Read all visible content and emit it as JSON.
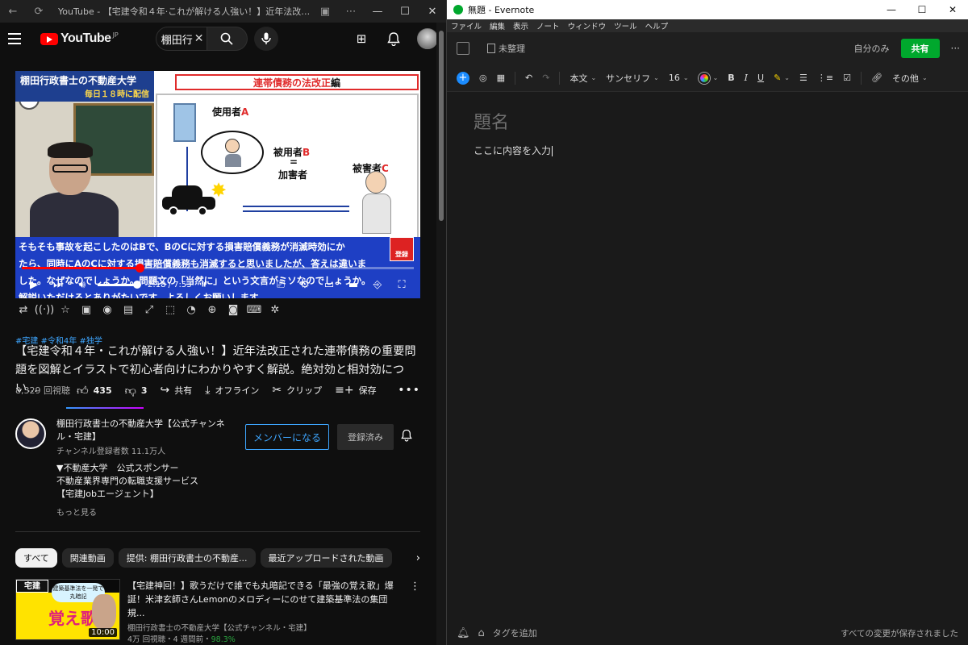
{
  "youtube_window": {
    "title": "YouTube - 【宅建令和４年·これが解ける人強い！】近年法改正された..."
  },
  "masthead": {
    "logo_text": "YouTube",
    "region": "JP",
    "search_value": "棚田行"
  },
  "player": {
    "header_channel": "棚田行政書士の不動産大学",
    "header_schedule": "毎日１８時に配信",
    "slide_topic_red": "連帯債務の法改正",
    "slide_topic_black": "編",
    "label_employer": "使用者",
    "label_employer_letter": "A",
    "label_employee": "被用者",
    "label_employee_letter": "B",
    "label_equals": "=",
    "label_perpetrator": "加害者",
    "label_victim": "被害者",
    "label_victim_letter": "C",
    "subtitle_lines": [
      "そもそも事故を起こしたのはBで、BのCに対する損害賠償義務が消滅時効にか",
      "たら、同時にAのCに対する損害賠償義務も消滅すると思いましたが、答えは違いま",
      "した。なぜなのでしょうか。問題文の「当然に」という文言がミソなのでしょうか。",
      "解説いただけるとありがたいです。よろしくお願いします。"
    ],
    "subscribe_badge": "登録",
    "progress_fraction": 0.3,
    "time": "2:18 / 7:53"
  },
  "video": {
    "hashtags": "#宅建 #令和4年 #独学",
    "title": "【宅建令和４年・これが解ける人強い！】近年法改正された連帯債務の重要問題を図解とイラストで初心者向けにわかりやすく解説。絶対効と相対効につい...",
    "views": "8,329 回視聴",
    "likes": "435",
    "dislikes": "3",
    "share": "共有",
    "offline": "オフライン",
    "clip": "クリップ",
    "save": "保存"
  },
  "channel": {
    "name": "棚田行政書士の不動産大学【公式チャンネル・宅建】",
    "subscribers": "チャンネル登録者数 11.1万人",
    "member_button": "メンバーになる",
    "subscribed_button": "登録済み",
    "description_lines": [
      "▼不動産大学　公式スポンサー",
      "不動産業界専門の転職支援サービス",
      "【宅建Jobエージェント】"
    ],
    "show_more": "もっと見る"
  },
  "chips": [
    "すべて",
    "関連動画",
    "提供: 棚田行政書士の不動産...",
    "最近アップロードされた動画"
  ],
  "related": {
    "title": "【宅建神回！】歌うだけで誰でも丸暗記できる「最強の覚え歌」爆誕！米津玄師さんLemonのメロディーにのせて建築基準法の集団規...",
    "channel": "棚田行政書士の不動産大学【公式チャンネル・宅建】",
    "meta": "4万 回視聴・4 週間前・",
    "percent": "98.3%",
    "duration": "10:00",
    "thumb_tag": "宅建",
    "thumb_sub": "建築基準法を一発で丸暗記",
    "thumb_big": "覚え歌"
  },
  "evernote": {
    "window_title": "無題 - Evernote",
    "menu": [
      "ファイル",
      "編集",
      "表示",
      "ノート",
      "ウィンドウ",
      "ツール",
      "ヘルプ"
    ],
    "notebook": "未整理",
    "visibility": "自分のみ",
    "share_button": "共有",
    "style_select": "本文",
    "font_select": "サンセリフ",
    "size_select": "16",
    "more_menu": "その他",
    "note_title_placeholder": "題名",
    "note_body": "ここに内容を入力",
    "add_tag": "タグを追加",
    "saved_status": "すべての変更が保存されました"
  },
  "colors": {
    "youtube_red": "#ff0000",
    "link_blue": "#3ea6ff",
    "evernote_green": "#00a82d",
    "subtitle_bg": "#1e3fc4"
  }
}
